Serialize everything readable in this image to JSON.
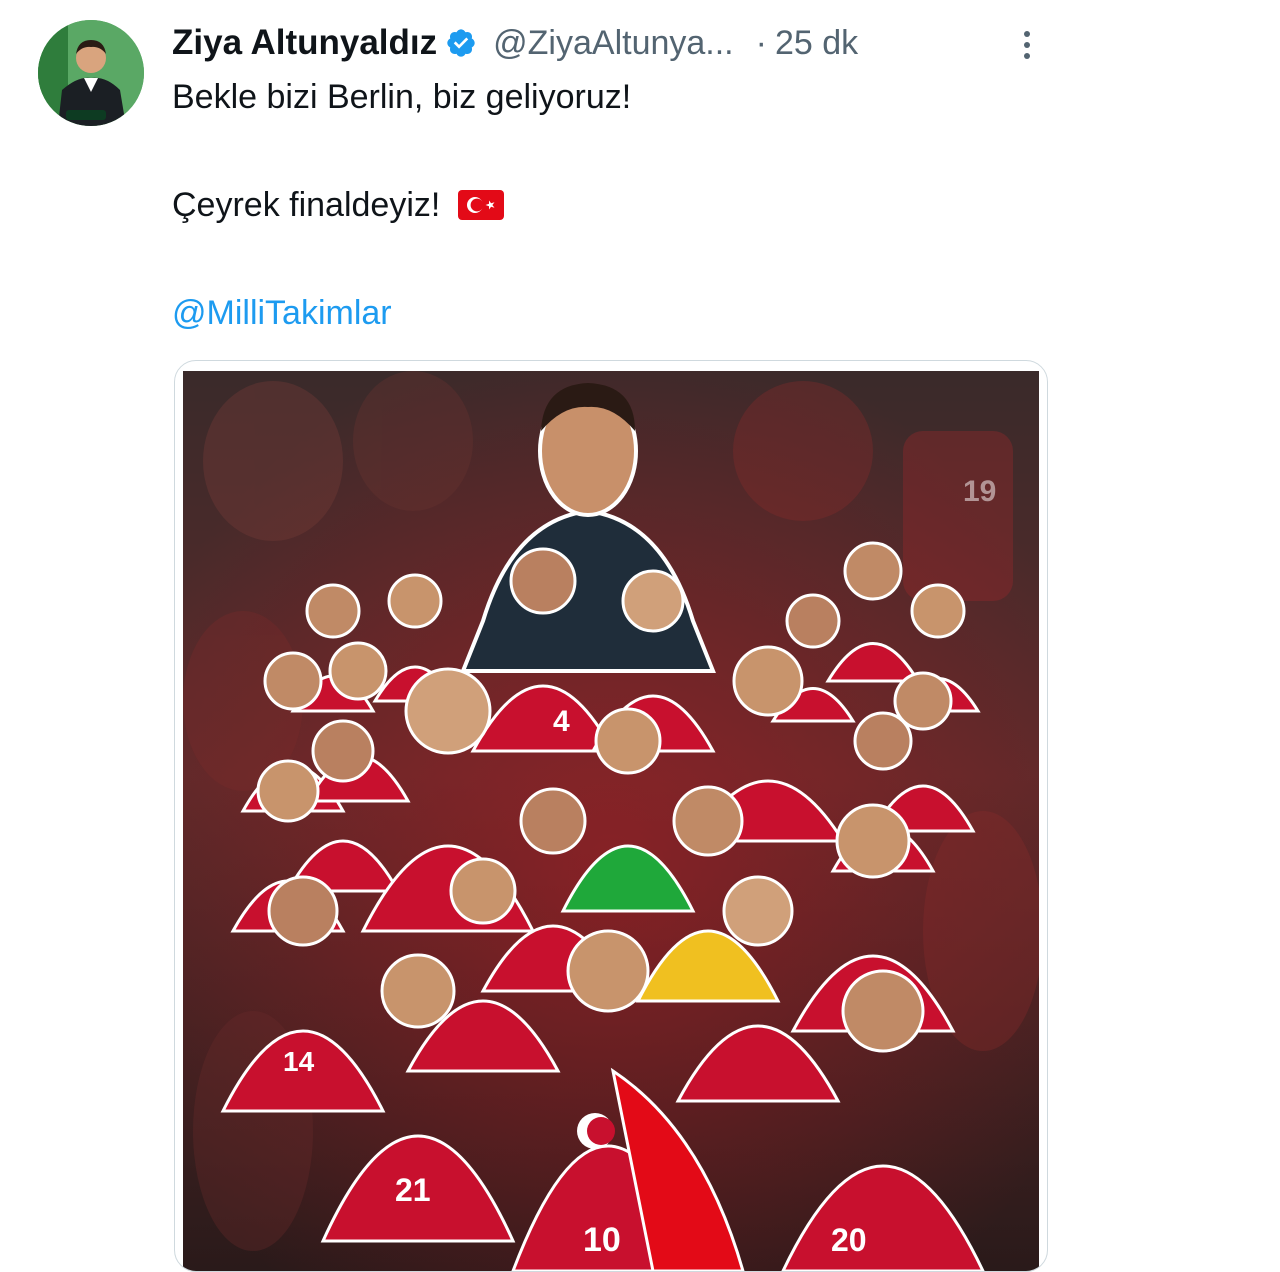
{
  "tweet": {
    "author": {
      "name": "Ziya Altunyaldız",
      "handle": "@ZiyaAltunya...",
      "verified": true,
      "avatar_icon": "profile-photo"
    },
    "time_separator": "·",
    "time": "25 dk",
    "text_line_1": "Bekle bizi Berlin, biz geliyoruz!",
    "text_line_2": "Çeyrek finaldeyiz!",
    "flag_icon": "turkey-flag-emoji",
    "mention": "@MilliTakimlar",
    "more_icon": "more-vertical-icon"
  },
  "media": {
    "shirt_numbers": [
      "4",
      "14",
      "21",
      "10",
      "20",
      "19"
    ]
  },
  "colors": {
    "text": "#0f1419",
    "secondary": "#536471",
    "link": "#1d9bf0",
    "verified": "#1d9bf0",
    "kit_red": "#c8102e"
  }
}
